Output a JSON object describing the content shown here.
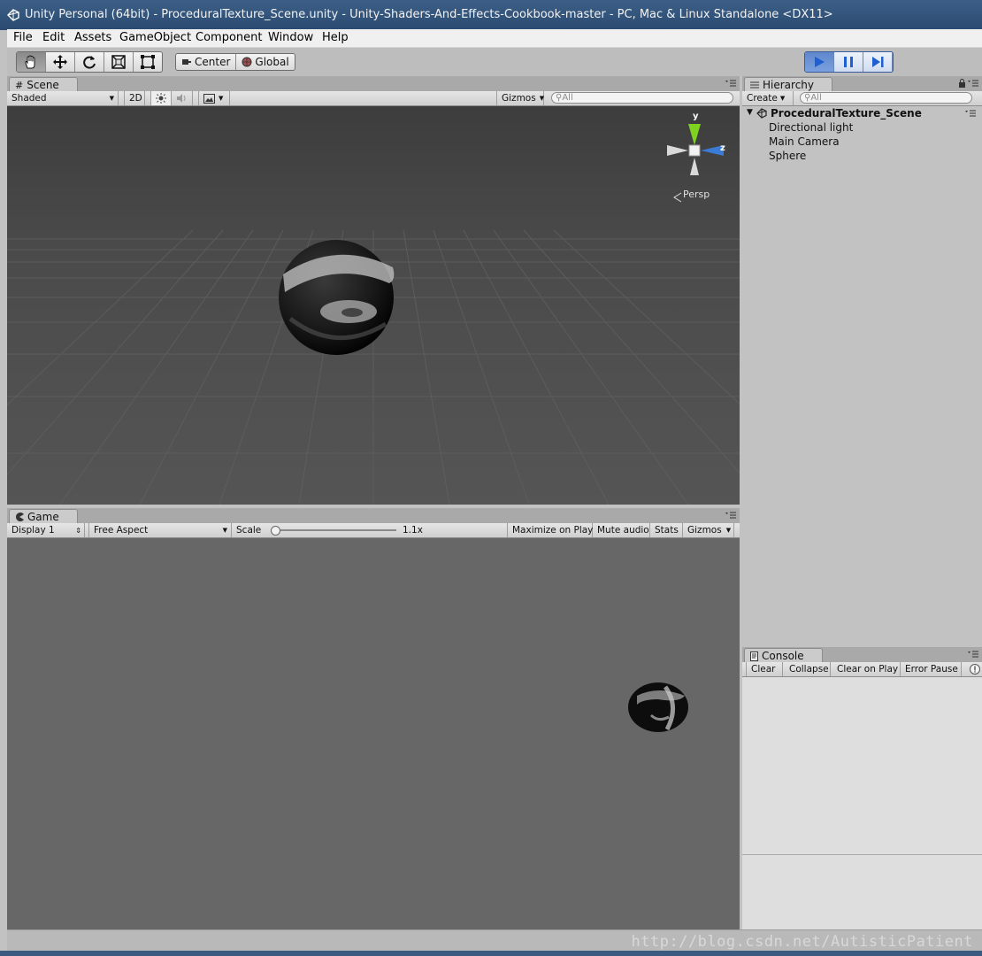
{
  "window": {
    "title": "Unity Personal (64bit) - ProceduralTexture_Scene.unity - Unity-Shaders-And-Effects-Cookbook-master - PC, Mac & Linux Standalone <DX11>"
  },
  "menu": [
    "File",
    "Edit",
    "Assets",
    "GameObject",
    "Component",
    "Window",
    "Help"
  ],
  "toolbar": {
    "tools": [
      "hand-icon",
      "move-icon",
      "rotate-icon",
      "scale-icon",
      "rect-icon"
    ],
    "pivot_mode": "Center",
    "pivot_rotation": "Global",
    "play_controls": [
      "play-icon",
      "pause-icon",
      "step-icon"
    ]
  },
  "scene": {
    "tab_label": "Scene",
    "shading": "Shaded",
    "mode_2d": "2D",
    "gizmos_label": "Gizmos",
    "search_placeholder": "All",
    "gizmo": {
      "y_label": "y",
      "z_label": "z",
      "projection": "Persp"
    }
  },
  "game": {
    "tab_label": "Game",
    "display": "Display 1",
    "aspect": "Free Aspect",
    "scale_label": "Scale",
    "scale_value": "1.1x",
    "maximize_label": "Maximize on Play",
    "mute_label": "Mute audio",
    "stats_label": "Stats",
    "gizmos_label": "Gizmos"
  },
  "hierarchy": {
    "tab_label": "Hierarchy",
    "create_label": "Create",
    "search_placeholder": "All",
    "scene_name": "ProceduralTexture_Scene",
    "items": [
      "Directional light",
      "Main Camera",
      "Sphere"
    ]
  },
  "console": {
    "tab_label": "Console",
    "buttons": [
      "Clear",
      "Collapse",
      "Clear on Play",
      "Error Pause"
    ]
  },
  "watermark": "http://blog.csdn.net/AutisticPatient"
}
